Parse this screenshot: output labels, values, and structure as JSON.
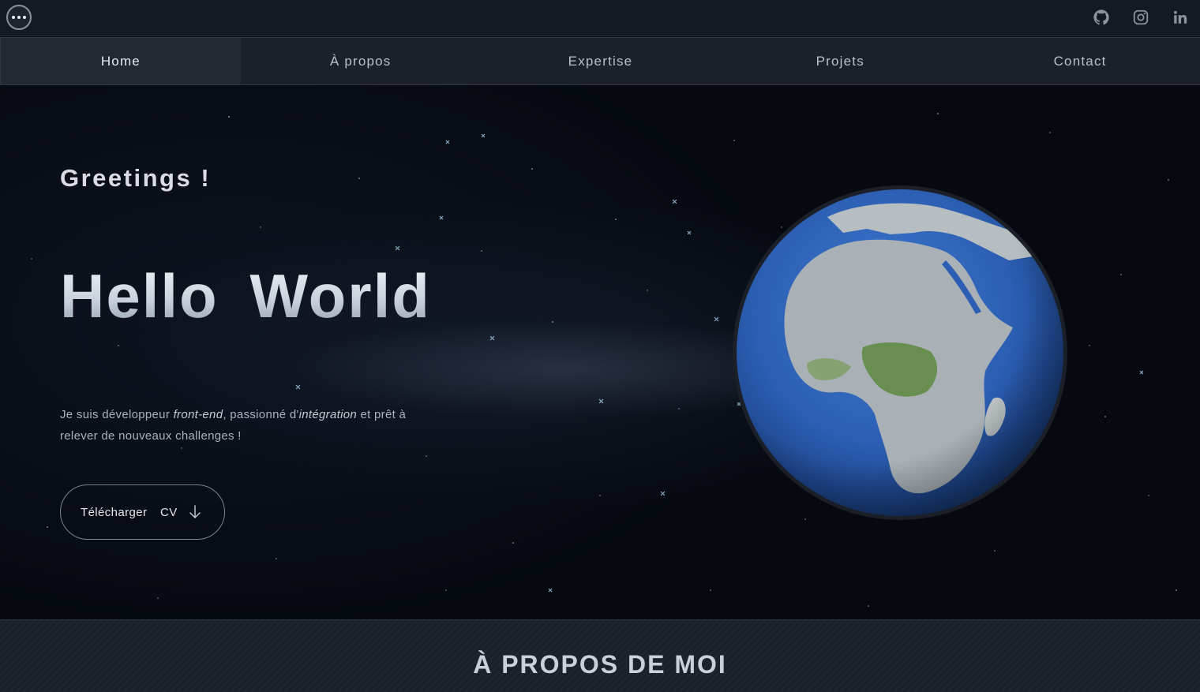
{
  "topbar": {
    "menu_icon": "more-dots-icon",
    "social_icons": [
      "github-icon",
      "instagram-icon",
      "linkedin-icon"
    ]
  },
  "nav": {
    "items": [
      {
        "label": "Home",
        "active": true
      },
      {
        "label": "À propos",
        "active": false
      },
      {
        "label": "Expertise",
        "active": false
      },
      {
        "label": "Projets",
        "active": false
      },
      {
        "label": "Contact",
        "active": false
      }
    ]
  },
  "hero": {
    "greeting": "Greetings !",
    "headline": "Hello World",
    "intro": {
      "part1": "Je suis développeur ",
      "em1": "front-end",
      "part2": ", passionné d'",
      "em2": "intégration",
      "part3": " et prêt à relever de nouveaux challenges !"
    },
    "cv_button": {
      "label": "Télécharger CV",
      "icon": "arrow-down-icon"
    },
    "globe_icon": "earth-globe"
  },
  "about": {
    "title": "À PROPOS DE MOI"
  },
  "colors": {
    "background": "#060910",
    "nav_bg": "#1c2129",
    "text_light": "#e6eaee",
    "ocean": "#2f63b8",
    "land": "#b9bfc0",
    "vegetation": "#5e8a3e"
  }
}
